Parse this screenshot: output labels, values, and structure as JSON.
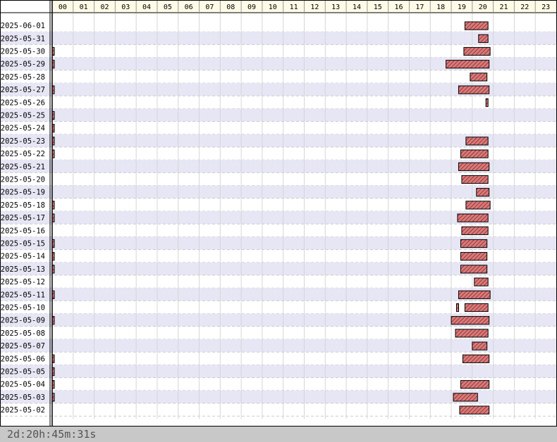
{
  "chart_data": {
    "type": "bar",
    "hours": [
      "00",
      "01",
      "02",
      "03",
      "04",
      "05",
      "06",
      "07",
      "08",
      "09",
      "10",
      "11",
      "12",
      "13",
      "14",
      "15",
      "16",
      "17",
      "18",
      "19",
      "20",
      "21",
      "22",
      "23"
    ],
    "rows": [
      {
        "date": "2025-06-01",
        "segments": [
          [
            19.65,
            20.75
          ]
        ]
      },
      {
        "date": "2025-05-31",
        "segments": [
          [
            20.3,
            20.75
          ]
        ]
      },
      {
        "date": "2025-05-30",
        "segments": [
          [
            0,
            0.05
          ],
          [
            19.6,
            20.85
          ]
        ]
      },
      {
        "date": "2025-05-29",
        "segments": [
          [
            0,
            0.05
          ],
          [
            18.75,
            20.8
          ]
        ]
      },
      {
        "date": "2025-05-28",
        "segments": [
          [
            19.9,
            20.7
          ]
        ]
      },
      {
        "date": "2025-05-27",
        "segments": [
          [
            0,
            0.05
          ],
          [
            19.35,
            20.8
          ]
        ]
      },
      {
        "date": "2025-05-26",
        "segments": [
          [
            20.65,
            20.75
          ]
        ]
      },
      {
        "date": "2025-05-25",
        "segments": [
          [
            0,
            0.05
          ]
        ]
      },
      {
        "date": "2025-05-24",
        "segments": [
          [
            0,
            0.05
          ]
        ]
      },
      {
        "date": "2025-05-23",
        "segments": [
          [
            0,
            0.05
          ],
          [
            19.7,
            20.75
          ]
        ]
      },
      {
        "date": "2025-05-22",
        "segments": [
          [
            0,
            0.05
          ],
          [
            19.45,
            20.75
          ]
        ]
      },
      {
        "date": "2025-05-21",
        "segments": [
          [
            19.35,
            20.8
          ]
        ]
      },
      {
        "date": "2025-05-20",
        "segments": [
          [
            19.5,
            20.75
          ]
        ]
      },
      {
        "date": "2025-05-19",
        "segments": [
          [
            20.2,
            20.8
          ]
        ]
      },
      {
        "date": "2025-05-18",
        "segments": [
          [
            0,
            0.05
          ],
          [
            19.7,
            20.85
          ]
        ]
      },
      {
        "date": "2025-05-17",
        "segments": [
          [
            0,
            0.05
          ],
          [
            19.3,
            20.75
          ]
        ]
      },
      {
        "date": "2025-05-16",
        "segments": [
          [
            19.5,
            20.75
          ]
        ]
      },
      {
        "date": "2025-05-15",
        "segments": [
          [
            0,
            0.05
          ],
          [
            19.45,
            20.7
          ]
        ]
      },
      {
        "date": "2025-05-14",
        "segments": [
          [
            0,
            0.05
          ],
          [
            19.45,
            20.7
          ]
        ]
      },
      {
        "date": "2025-05-13",
        "segments": [
          [
            0,
            0.05
          ],
          [
            19.45,
            20.7
          ]
        ]
      },
      {
        "date": "2025-05-12",
        "segments": [
          [
            20.1,
            20.75
          ]
        ]
      },
      {
        "date": "2025-05-11",
        "segments": [
          [
            0,
            0.05
          ],
          [
            19.35,
            20.85
          ]
        ]
      },
      {
        "date": "2025-05-10",
        "segments": [
          [
            19.25,
            19.35
          ],
          [
            19.65,
            20.75
          ]
        ]
      },
      {
        "date": "2025-05-09",
        "segments": [
          [
            0,
            0.05
          ],
          [
            19.0,
            20.8
          ]
        ]
      },
      {
        "date": "2025-05-08",
        "segments": [
          [
            19.2,
            20.75
          ]
        ]
      },
      {
        "date": "2025-05-07",
        "segments": [
          [
            20.0,
            20.7
          ]
        ]
      },
      {
        "date": "2025-05-06",
        "segments": [
          [
            0,
            0.05
          ],
          [
            19.55,
            20.8
          ]
        ]
      },
      {
        "date": "2025-05-05",
        "segments": [
          [
            0,
            0.05
          ]
        ]
      },
      {
        "date": "2025-05-04",
        "segments": [
          [
            0,
            0.05
          ],
          [
            19.45,
            20.8
          ]
        ]
      },
      {
        "date": "2025-05-03",
        "segments": [
          [
            0,
            0.05
          ],
          [
            19.1,
            20.25
          ]
        ]
      },
      {
        "date": "2025-05-02",
        "segments": [
          [
            19.4,
            20.8
          ]
        ]
      }
    ],
    "x_range": [
      0,
      24
    ],
    "grid": true
  },
  "colors": {
    "bar_fill": "#d97a7a",
    "bar_stripe": "#7a1f1f",
    "row_alt": "#e6e6f5",
    "header_bg": "#fffbe6"
  },
  "footer": {
    "duration": "2d:20h:45m:31s"
  }
}
